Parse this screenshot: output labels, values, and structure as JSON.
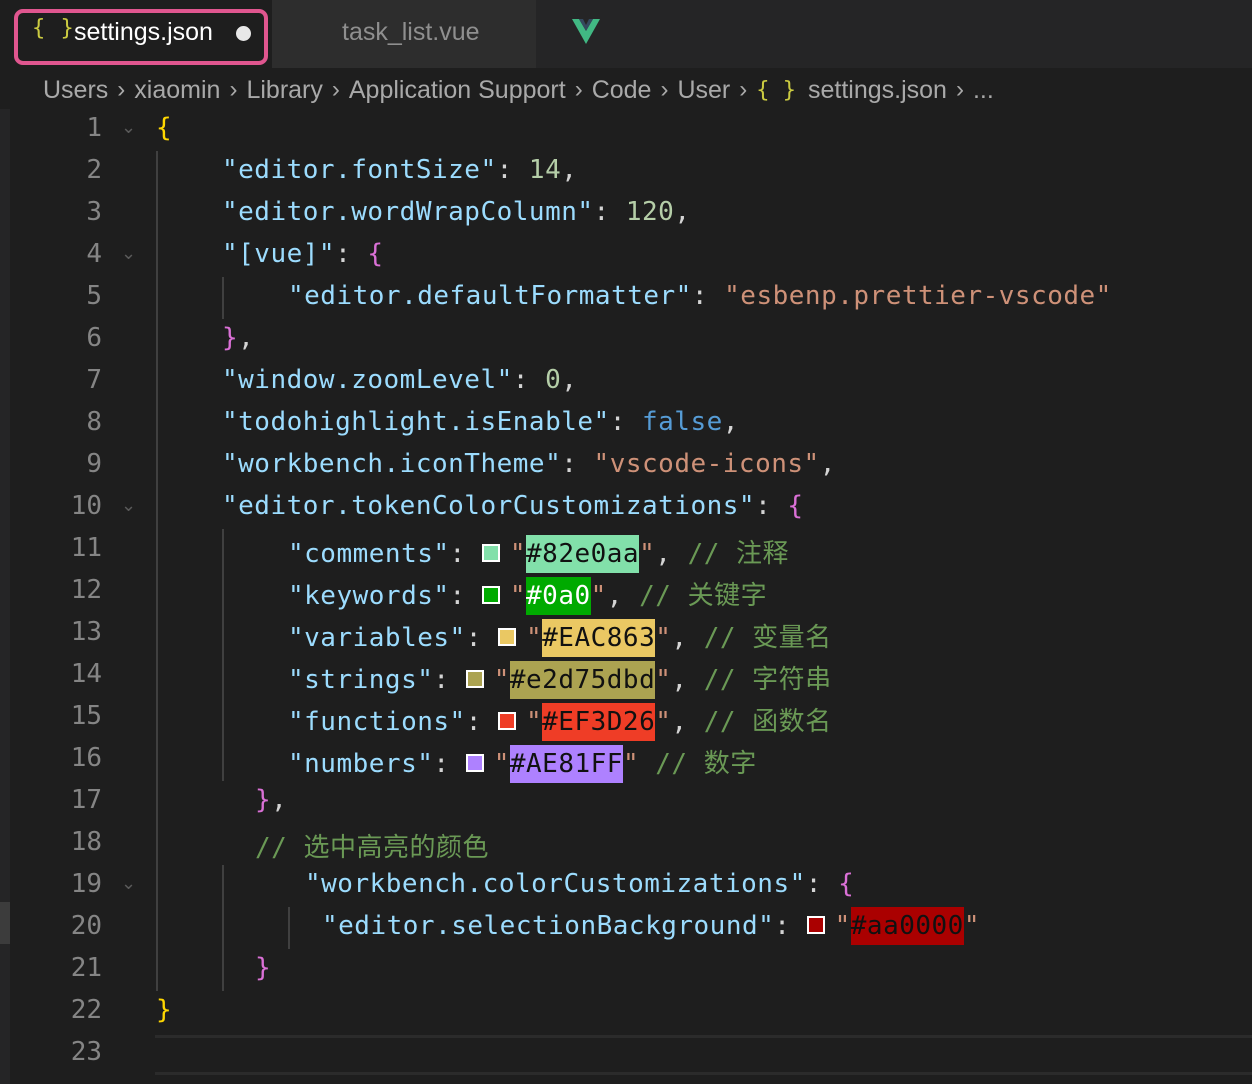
{
  "tabs": {
    "active": {
      "icon": "{ }",
      "label": "settings.json",
      "dirty": true
    },
    "inactive": {
      "label": "task_list.vue"
    }
  },
  "breadcrumb": [
    "Users",
    "xiaomin",
    "Library",
    "Application Support",
    "Code",
    "User",
    "settings.json",
    "..."
  ],
  "breadcrumb_icon": "{ }",
  "colors": {
    "comments": "#82e0aa",
    "keywords": "#0a0",
    "variables": "#EAC863",
    "strings": "#e2d75dbd",
    "functions": "#EF3D26",
    "numbers": "#AE81FF",
    "selection": "#aa0000"
  },
  "code": {
    "l1": "{",
    "l2_key": "\"editor.fontSize\"",
    "l2_val": "14",
    "l3_key": "\"editor.wordWrapColumn\"",
    "l3_val": "120",
    "l4_key": "\"[vue]\"",
    "l4_brace": "{",
    "l5_key": "\"editor.defaultFormatter\"",
    "l5_val": "\"esbenp.prettier-vscode\"",
    "l6_brace": "}",
    "l7_key": "\"window.zoomLevel\"",
    "l7_val": "0",
    "l8_key": "\"todohighlight.isEnable\"",
    "l8_val": "false",
    "l9_key": "\"workbench.iconTheme\"",
    "l9_val": "\"vscode-icons\"",
    "l10_key": "\"editor.tokenColorCustomizations\"",
    "l10_brace": "{",
    "l11_key": "\"comments\"",
    "l11_hex": "#82e0aa",
    "l11_comment": "// 注释",
    "l12_key": "\"keywords\"",
    "l12_hex": "#0a0",
    "l12_comment": "// 关键字",
    "l13_key": "\"variables\"",
    "l13_hex": "#EAC863",
    "l13_comment": "// 变量名",
    "l14_key": "\"strings\"",
    "l14_hex": "#e2d75dbd",
    "l14_comment": "// 字符串",
    "l15_key": "\"functions\"",
    "l15_hex": "#EF3D26",
    "l15_comment": "// 函数名",
    "l16_key": "\"numbers\"",
    "l16_hex": "#AE81FF",
    "l16_comment": "// 数字",
    "l17_brace": "}",
    "l18_comment": "// 选中高亮的颜色",
    "l19_key": "\"workbench.colorCustomizations\"",
    "l19_brace": "{",
    "l20_key": "\"editor.selectionBackground\"",
    "l20_hex": "#aa0000",
    "l21_brace": "}",
    "l22": "}"
  },
  "line_numbers": [
    "1",
    "2",
    "3",
    "4",
    "5",
    "6",
    "7",
    "8",
    "9",
    "10",
    "11",
    "12",
    "13",
    "14",
    "15",
    "16",
    "17",
    "18",
    "19",
    "20",
    "21",
    "22",
    "23"
  ]
}
